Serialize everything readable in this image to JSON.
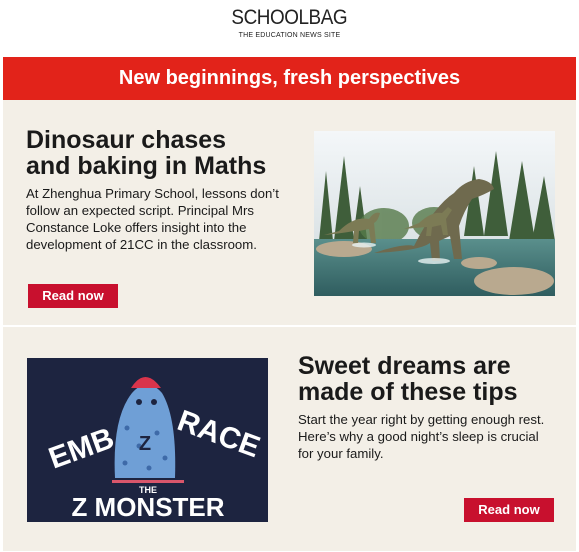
{
  "brand": {
    "name": "SCHOOLBAG",
    "tagline": "THE EDUCATION NEWS SITE"
  },
  "banner": {
    "text": "New beginnings, fresh perspectives"
  },
  "articles": [
    {
      "title_line1": "Dinosaur chases",
      "title_line2": "and baking in Maths",
      "description": "At Zhenghua Primary School, lessons don’t follow an expected script. Principal Mrs Constance Loke offers insight into the development of 21CC in the classroom.",
      "cta": "Read now",
      "image": "dinosaur-photo"
    },
    {
      "title_line1": "Sweet dreams are",
      "title_line2": "made of these tips",
      "description": "Start the year right by getting enough rest. Here’s why a good night’s sleep is crucial for your family.",
      "cta": "Read now",
      "image": "z-monster-illustration",
      "poster": {
        "word1": "EMB",
        "word2": "RACE",
        "the": "THE",
        "bottom": "Z MONSTER",
        "z": "Z"
      }
    }
  ],
  "colors": {
    "brand_red": "#e2231a",
    "button_red": "#c8102e",
    "card_bg": "#f3efe7",
    "poster_navy": "#1d2440"
  }
}
